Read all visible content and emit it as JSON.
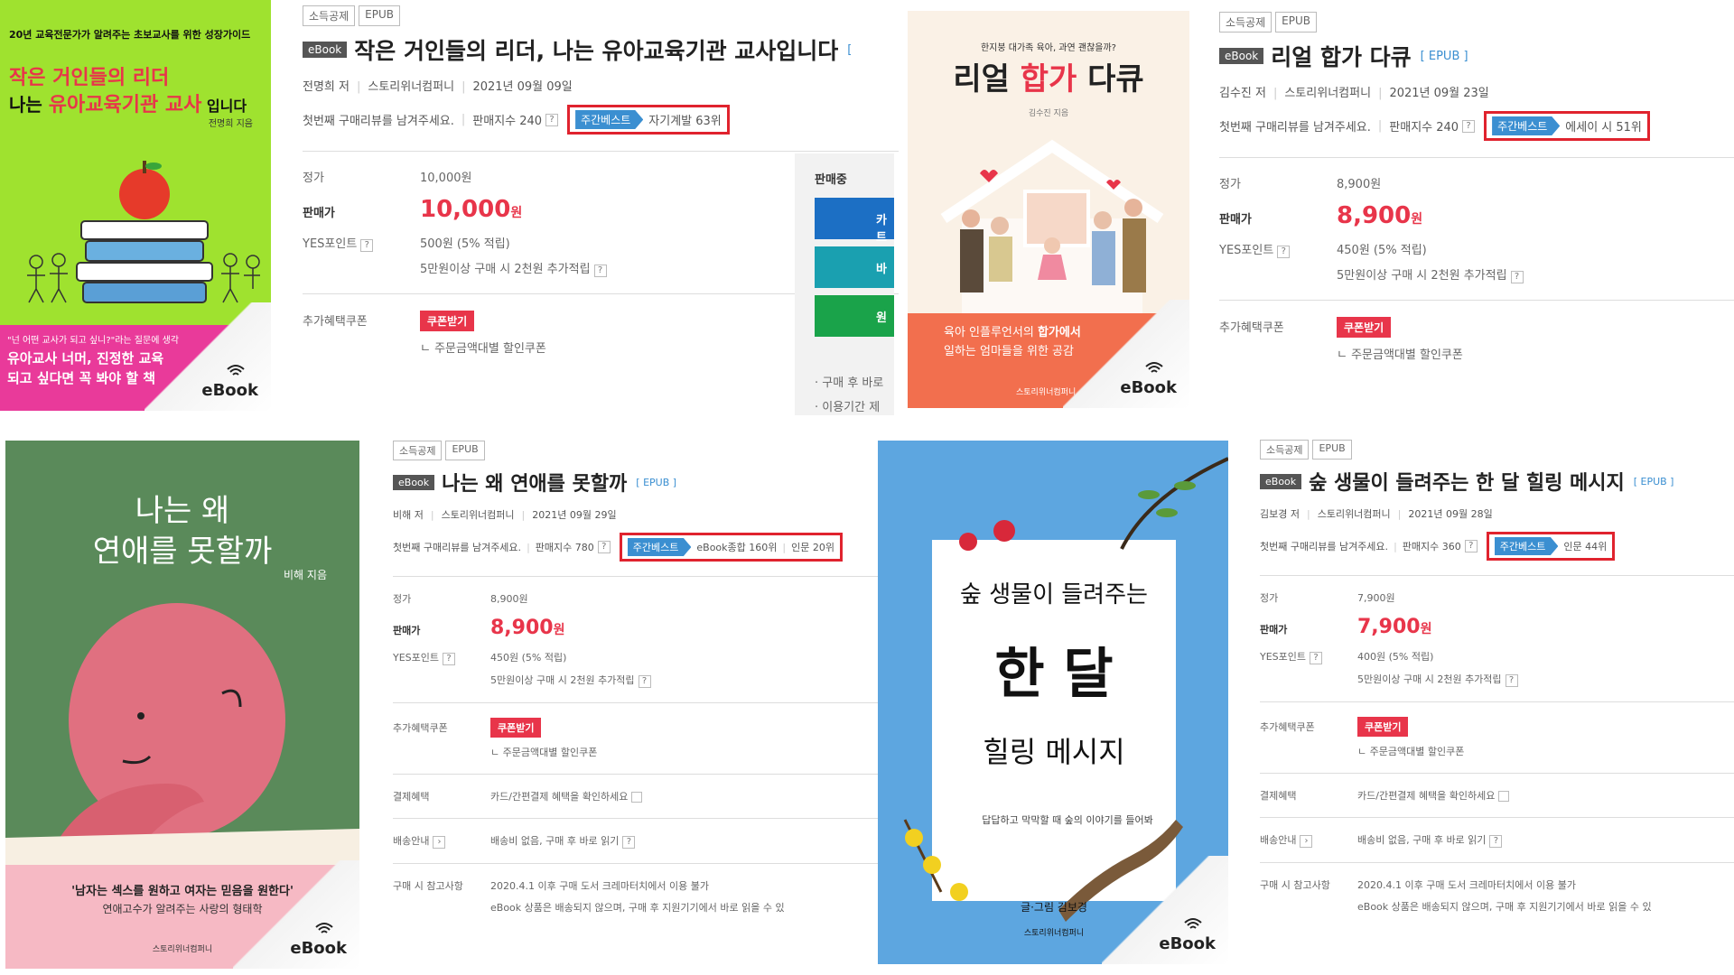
{
  "books": [
    {
      "tags": [
        "소득공제",
        "EPUB"
      ],
      "badge": "eBook",
      "title": "작은 거인들의 리더, 나는 유아교육기관 교사입니다",
      "epub_tag": "[",
      "author": "전명희 저",
      "publisher": "스토리위너컴퍼니",
      "date": "2021년 09월 09일",
      "review": "첫번째 구매리뷰를 남겨주세요.",
      "sales": "판매지수 240",
      "best_label": "주간베스트",
      "best_rank": "자기계발 63위",
      "best_rank2": "",
      "list_price_label": "정가",
      "list_price": "10,000원",
      "price_label": "판매가",
      "price": "10,000",
      "price_unit": "원",
      "point_label": "YES포인트",
      "point": "500원 (5% 적립)",
      "extra_point": "5만원이상 구매 시 2천원 추가적립",
      "coupon_label": "추가혜택쿠폰",
      "coupon_btn": "쿠폰받기",
      "coupon_sub": "ㄴ 주문금액대별 할인쿠폰",
      "cover": {
        "top": "20년 교육전문가가 알려주는 초보교사를 위한 성장가이드",
        "line1": "작은 거인들의 리더",
        "line2a": "나는 ",
        "line2b": "유아교육기관 교사",
        "line2c": " 입니다",
        "author": "전명희 지음",
        "quote": "\"넌 어떤 교사가 되고 싶니?\"라는 질문에 생각",
        "b1": "유아교사 너머, 진정한 교육",
        "b2": "되고 싶다면 꼭 봐야 할 책",
        "ebook": "eBook"
      }
    },
    {
      "tags": [
        "소득공제",
        "EPUB"
      ],
      "badge": "eBook",
      "title": "리얼 합가 다큐",
      "epub_tag": "[ EPUB ]",
      "author": "김수진 저",
      "publisher": "스토리위너컴퍼니",
      "date": "2021년 09월 23일",
      "review": "첫번째 구매리뷰를 남겨주세요.",
      "sales": "판매지수 240",
      "best_label": "주간베스트",
      "best_rank": "에세이 시 51위",
      "best_rank2": "",
      "list_price_label": "정가",
      "list_price": "8,900원",
      "price_label": "판매가",
      "price": "8,900",
      "price_unit": "원",
      "point_label": "YES포인트",
      "point": "450원 (5% 적립)",
      "extra_point": "5만원이상 구매 시 2천원 추가적립",
      "coupon_label": "추가혜택쿠폰",
      "coupon_btn": "쿠폰받기",
      "coupon_sub": "ㄴ 주문금액대별 할인쿠폰",
      "cover": {
        "top": "한지붕 대가족 육아, 과연 괜찮을까?",
        "t1": "리얼 ",
        "t2": "합가",
        "t3": " 다큐",
        "author": "김수진 지음",
        "b1a": "육아 인플루언서의 ",
        "b1b": "합가에서",
        "b2": "일하는 엄마들을 위한 공감",
        "pub": "스토리위너컴퍼니",
        "ebook": "eBook"
      }
    },
    {
      "tags": [
        "소득공제",
        "EPUB"
      ],
      "badge": "eBook",
      "title": "나는 왜 연애를 못할까",
      "epub_tag": "[ EPUB ]",
      "author": "비해 저",
      "publisher": "스토리위너컴퍼니",
      "date": "2021년 09월 29일",
      "review": "첫번째 구매리뷰를 남겨주세요.",
      "sales": "판매지수 780",
      "best_label": "주간베스트",
      "best_rank": "eBook종합 160위",
      "best_rank2": "인문 20위",
      "list_price_label": "정가",
      "list_price": "8,900원",
      "price_label": "판매가",
      "price": "8,900",
      "price_unit": "원",
      "point_label": "YES포인트",
      "point": "450원 (5% 적립)",
      "extra_point": "5만원이상 구매 시 2천원 추가적립",
      "coupon_label": "추가혜택쿠폰",
      "coupon_btn": "쿠폰받기",
      "coupon_sub": "ㄴ 주문금액대별 할인쿠폰",
      "pay_label": "결제혜택",
      "pay": "카드/간편결제 혜택을 확인하세요",
      "ship_label": "배송안내",
      "ship": "배송비 없음, 구매 후 바로 읽기",
      "note_label": "구매 시 참고사항",
      "note": "2020.4.1 이후 구매 도서 크레마터치에서 이용 불가",
      "note2": "eBook 상품은 배송되지 않으며, 구매 후 지원기기에서 바로 읽을 수 있",
      "cover": {
        "t1": "나는 왜",
        "t2": "연애를 못할까",
        "author": "비해 지음",
        "q1": "'남자는 섹스를 원하고 여자는 믿음을 원한다'",
        "q2": "연애고수가 알려주는 사랑의 형태학",
        "pub": "스토리위너컴퍼니",
        "ebook": "eBook"
      }
    },
    {
      "tags": [
        "소득공제",
        "EPUB"
      ],
      "badge": "eBook",
      "title": "숲 생물이 들려주는 한 달 힐링 메시지",
      "epub_tag": "[ EPUB ]",
      "author": "김보경 저",
      "publisher": "스토리위너컴퍼니",
      "date": "2021년 09월 28일",
      "review": "첫번째 구매리뷰를 남겨주세요.",
      "sales": "판매지수 360",
      "best_label": "주간베스트",
      "best_rank": "인문 44위",
      "best_rank2": "",
      "list_price_label": "정가",
      "list_price": "7,900원",
      "price_label": "판매가",
      "price": "7,900",
      "price_unit": "원",
      "point_label": "YES포인트",
      "point": "400원 (5% 적립)",
      "extra_point": "5만원이상 구매 시 2천원 추가적립",
      "coupon_label": "추가혜택쿠폰",
      "coupon_btn": "쿠폰받기",
      "coupon_sub": "ㄴ 주문금액대별 할인쿠폰",
      "pay_label": "결제혜택",
      "pay": "카드/간편결제 혜택을 확인하세요",
      "ship_label": "배송안내",
      "ship": "배송비 없음, 구매 후 바로 읽기",
      "note_label": "구매 시 참고사항",
      "note": "2020.4.1 이후 구매 도서 크레마터치에서 이용 불가",
      "note2": "eBook 상품은 배송되지 않으며, 구매 후 지원기기에서 바로 읽을 수 있",
      "cover": {
        "t1": "숲 생물이 들려주는",
        "t2": "한 달",
        "t3": "힐링 메시지",
        "sub": "답답하고 막막할 때 숲의 이야기를 들어봐",
        "author": "글·그림 김보경",
        "pub": "스토리위너컴퍼니",
        "ebook": "eBook"
      }
    }
  ],
  "side_panel": {
    "status": "판매중",
    "btn1": "카트",
    "btn2": "바",
    "btn3": "원",
    "n1": "· 구매 후 바로",
    "n2": "· 이용기간 제"
  },
  "colors": {
    "accent_red": "#e8354a",
    "best_blue": "#3b8fd1",
    "highlight_red": "#e0232e"
  }
}
